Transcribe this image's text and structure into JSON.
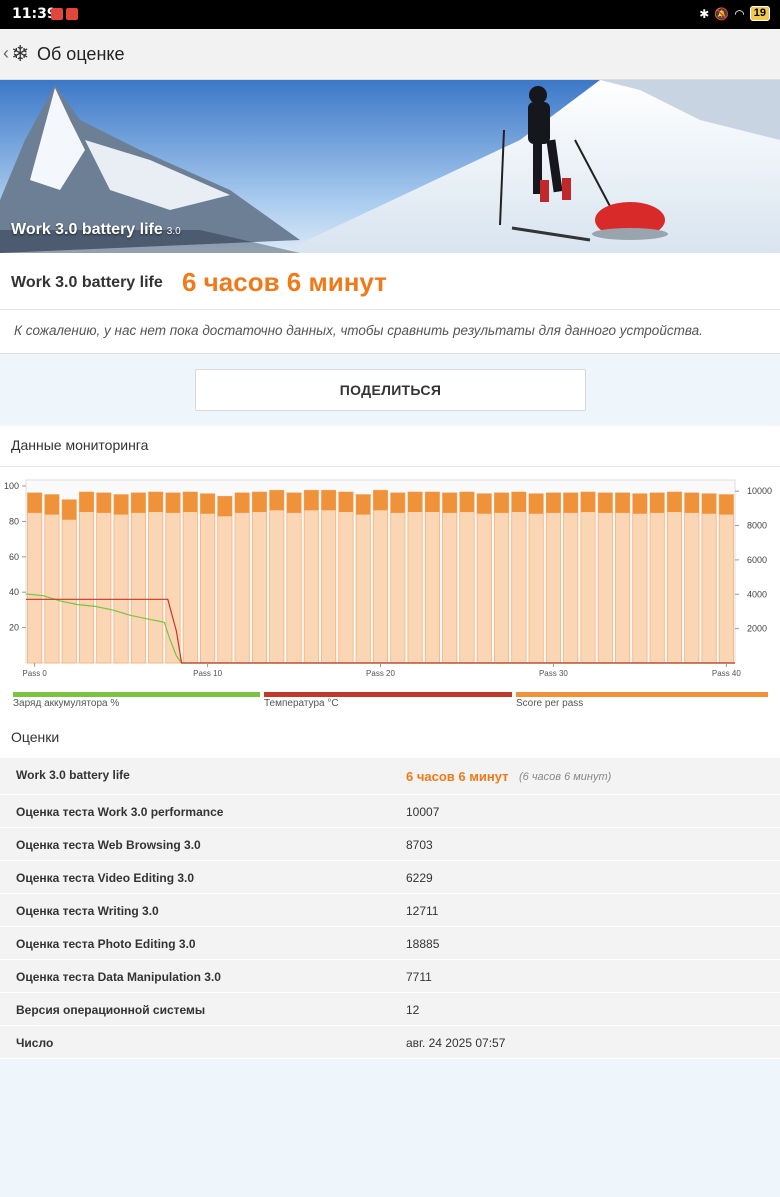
{
  "status_bar": {
    "time": "11:39",
    "battery": "19"
  },
  "app_bar": {
    "back_glyph": "‹",
    "title": "Об оценке"
  },
  "hero": {
    "label": "Work 3.0 battery life",
    "version": "3.0"
  },
  "result": {
    "name": "Work 3.0 battery life",
    "value": "6 часов 6 минут",
    "note": "К сожалению, у нас нет пока достаточно данных, чтобы сравнить результаты для данного устройства."
  },
  "share_label": "ПОДЕЛИТЬСЯ",
  "monitoring": {
    "title": "Данные мониторинга",
    "legend": [
      {
        "label": "Заряд аккумулятора %",
        "color": "#7cc243"
      },
      {
        "label": "Температура °C",
        "color": "#c0392b"
      },
      {
        "label": "Score per pass",
        "color": "#f0923a"
      }
    ]
  },
  "chart_data": {
    "type": "bar",
    "left_axis": {
      "ticks": [
        20,
        40,
        60,
        80,
        100
      ],
      "ylim": [
        0,
        100
      ]
    },
    "right_axis": {
      "ticks": [
        2000,
        4000,
        6000,
        8000,
        10000
      ],
      "ylim": [
        0,
        10300
      ]
    },
    "x_ticks": [
      "Pass 0",
      "Pass 10",
      "Pass 20",
      "Pass 30",
      "Pass 40"
    ],
    "series": [
      {
        "name": "Score per pass",
        "axis": "right",
        "color": "#f0923a",
        "values": [
          9900,
          9800,
          9500,
          9950,
          9900,
          9800,
          9900,
          9950,
          9900,
          9950,
          9850,
          9700,
          9900,
          9950,
          10050,
          9900,
          10050,
          10050,
          9950,
          9800,
          10050,
          9900,
          9950,
          9950,
          9900,
          9950,
          9850,
          9900,
          9950,
          9850,
          9900,
          9900,
          9950,
          9900,
          9900,
          9850,
          9900,
          9950,
          9900,
          9850,
          9800
        ]
      },
      {
        "name": "Заряд аккумулятора %",
        "axis": "left",
        "color": "#7cc243",
        "x": [
          0,
          1,
          2,
          3,
          4,
          5,
          6,
          7,
          8,
          8.3,
          8.7,
          9,
          41
        ],
        "values": [
          39,
          38,
          35,
          33,
          32,
          30,
          27,
          25,
          23,
          14,
          4,
          0,
          0
        ]
      },
      {
        "name": "Температура °C",
        "axis": "left",
        "color": "#c0392b",
        "x": [
          0,
          8.2,
          8.7,
          9,
          41
        ],
        "values": [
          36,
          36,
          18,
          0,
          0
        ]
      }
    ]
  },
  "scores": {
    "title": "Оценки",
    "first": {
      "label": "Work 3.0 battery life",
      "value": "6 часов 6 минут",
      "sub": "(6 часов 6 минут)"
    },
    "rows": [
      {
        "label": "Оценка теста Work 3.0 performance",
        "value": "10007"
      },
      {
        "label": "Оценка теста Web Browsing 3.0",
        "value": "8703"
      },
      {
        "label": "Оценка теста Video Editing 3.0",
        "value": "6229"
      },
      {
        "label": "Оценка теста Writing 3.0",
        "value": "12711"
      },
      {
        "label": "Оценка теста Photo Editing 3.0",
        "value": "18885"
      },
      {
        "label": "Оценка теста Data Manipulation 3.0",
        "value": "7711"
      },
      {
        "label": "Версия операционной системы",
        "value": "12"
      },
      {
        "label": "Число",
        "value": "авг. 24 2025 07:57"
      }
    ]
  }
}
